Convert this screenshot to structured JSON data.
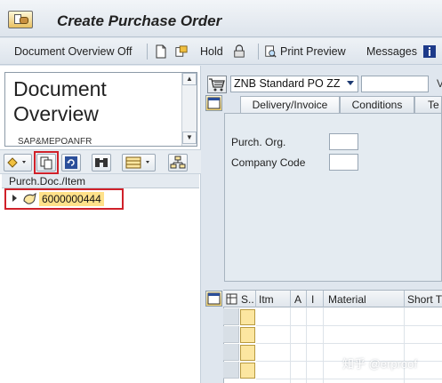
{
  "window": {
    "title": "Create Purchase Order"
  },
  "toolbar": {
    "doc_overview_label": "Document Overview Off",
    "hold_label": "Hold",
    "print_preview_label": "Print Preview",
    "messages_label": "Messages"
  },
  "left_panel": {
    "header_title": "Document Overview",
    "header_user": "SAP&MEPOANFR",
    "column_header": "Purch.Doc./Item",
    "tree_items": [
      {
        "value": "6000000444",
        "selected": true
      }
    ]
  },
  "po_header": {
    "doc_type_value": "ZNB Standard PO ZZ",
    "vendor_label_truncated": "V",
    "tabs": [
      {
        "label": "Delivery/Invoice"
      },
      {
        "label": "Conditions"
      },
      {
        "label": "Te"
      }
    ],
    "fields": [
      {
        "label": "Purch. Org.",
        "value": ""
      },
      {
        "label": "Company Code",
        "value": ""
      }
    ]
  },
  "items_grid": {
    "columns": [
      "S..",
      "Itm",
      "A",
      "I",
      "Material",
      "Short T"
    ],
    "row_count": 4
  },
  "watermark": "知乎 @erproof",
  "colors": {
    "highlight_red": "#d0212a",
    "selected_yellow": "#ffe18a",
    "background": "#dfe6ee"
  }
}
